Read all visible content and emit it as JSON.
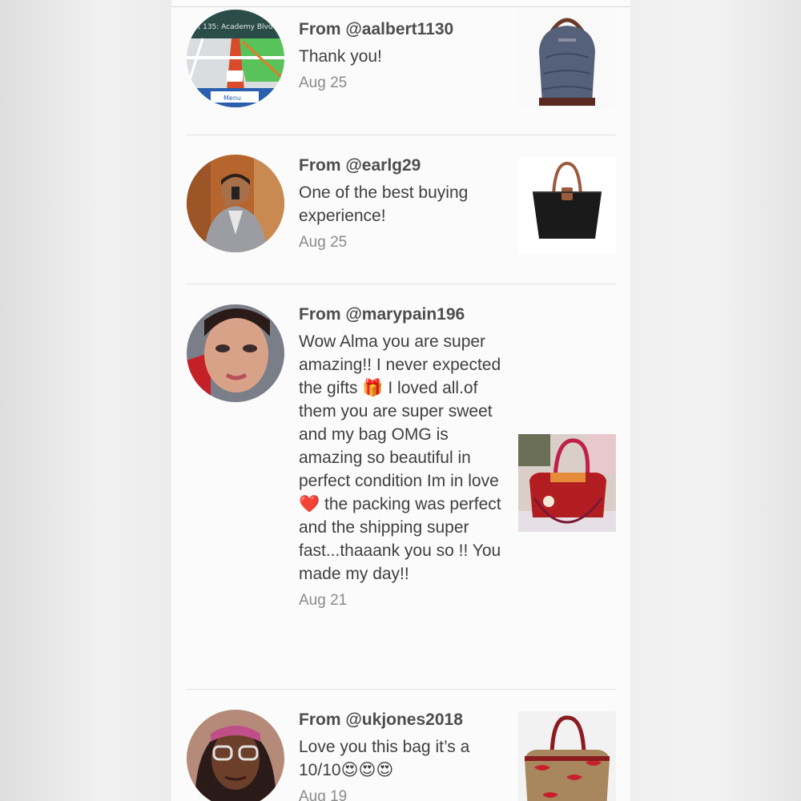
{
  "reviews": [
    {
      "from": "From @aalbert1130",
      "message": "Thank you!",
      "date": "Aug 25",
      "avatar_icon": "gps-map-avatar",
      "thumb_icon": "blue-croc-backpack-thumbnail"
    },
    {
      "from": "From @earlg29",
      "message": "One of the best buying experience!",
      "date": "Aug 25",
      "avatar_icon": "man-selfie-avatar",
      "thumb_icon": "black-tote-bag-thumbnail"
    },
    {
      "from": "From @marypain196",
      "message_parts": [
        "Wow Alma you are super amazing!! I never expected the gifts ",
        "🎁",
        " I loved all.of them you are super sweet and my bag OMG is amazing so beautiful in perfect condition Im in love ",
        "❤️",
        " the packing was perfect and the shipping super fast...thaaank you so !! You made my day!!"
      ],
      "date": "Aug 21",
      "avatar_icon": "woman-portrait-avatar",
      "thumb_icon": "red-satchel-bag-thumbnail"
    },
    {
      "from": "From @ukjones2018",
      "message_parts": [
        "Love you this bag it’s a 10/10",
        "😍😍😍"
      ],
      "date": "Aug 19",
      "avatar_icon": "woman-glasses-avatar",
      "thumb_icon": "lips-print-satchel-thumbnail"
    }
  ],
  "colors": {
    "text_primary": "#3f3f3f",
    "text_secondary": "#8a8a8a",
    "divider": "#e3e3e3",
    "background": "#fbfbfb"
  }
}
